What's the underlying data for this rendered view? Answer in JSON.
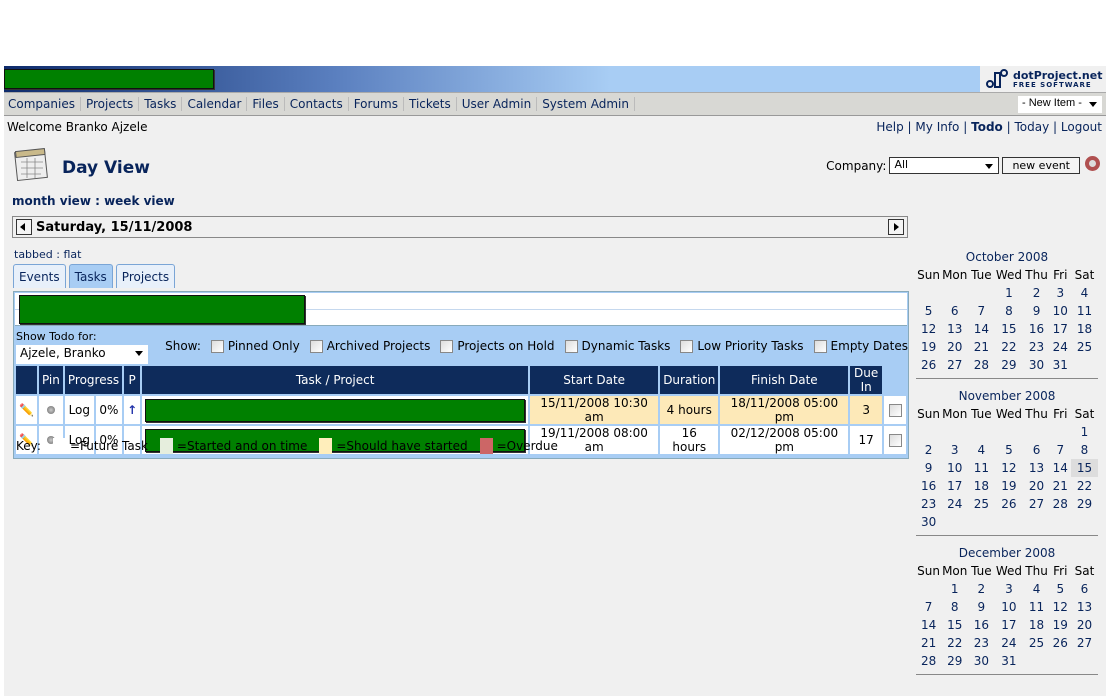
{
  "header": {
    "logo_line1": "dotProject.net",
    "logo_line2": "FREE SOFTWARE",
    "new_item": "- New Item -"
  },
  "nav": [
    "Companies",
    "Projects",
    "Tasks",
    "Calendar",
    "Files",
    "Contacts",
    "Forums",
    "Tickets",
    "User Admin",
    "System Admin"
  ],
  "welcome": "Welcome Branko Ajzele",
  "toplinks": {
    "help": "Help",
    "myinfo": "My Info",
    "todo": "Todo",
    "today": "Today",
    "logout": "Logout",
    "sep": "|"
  },
  "page_title": "Day View",
  "company": {
    "label": "Company:",
    "value": "All",
    "new_event": "new event"
  },
  "views": {
    "month": "month view",
    "sep": " : ",
    "week": "week view"
  },
  "current_day": "Saturday, 15/11/2008",
  "layout_links": {
    "tabbed": "tabbed",
    "sep": " : ",
    "flat": "flat"
  },
  "tabs": [
    {
      "label": "Events"
    },
    {
      "label": "Tasks",
      "active": true
    },
    {
      "label": "Projects"
    }
  ],
  "todo": {
    "show_for_label": "Show Todo for:",
    "user": "Ajzele, Branko",
    "show_label": "Show:",
    "options": [
      "Pinned Only",
      "Archived Projects",
      "Projects on Hold",
      "Dynamic Tasks",
      "Low Priority Tasks",
      "Empty Dates"
    ]
  },
  "columns": [
    "",
    "Pin",
    "Progress",
    "P",
    "Task / Project",
    "Start Date",
    "Duration",
    "Finish Date",
    "Due In"
  ],
  "rows": [
    {
      "log": "Log",
      "progress": "0%",
      "priority": "high",
      "start": "15/11/2008 10:30 am",
      "duration": "4 hours",
      "finish": "18/11/2008 05:00 pm",
      "due_in": "3",
      "status": "should-have-started"
    },
    {
      "log": "Log",
      "progress": "0%",
      "priority": "",
      "start": "19/11/2008 08:00 am",
      "duration": "16 hours",
      "finish": "02/12/2008 05:00 pm",
      "due_in": "17",
      "status": "future"
    }
  ],
  "key": {
    "label": "Key:",
    "items": [
      {
        "label": "=Future Task",
        "color": "#ffffff"
      },
      {
        "label": "=Started and on time",
        "color": "#e6eedd"
      },
      {
        "label": "=Should have started",
        "color": "#ffeebb"
      },
      {
        "label": "=Overdue",
        "color": "#cc6666"
      }
    ]
  },
  "calendar": {
    "weekdays": [
      "Sun",
      "Mon",
      "Tue",
      "Wed",
      "Thu",
      "Fri",
      "Sat"
    ],
    "today": "15/11/2008",
    "months": [
      {
        "title": "October 2008",
        "weeks": [
          [
            "",
            "",
            "",
            "1",
            "2",
            "3",
            "4"
          ],
          [
            "5",
            "6",
            "7",
            "8",
            "9",
            "10",
            "11"
          ],
          [
            "12",
            "13",
            "14",
            "15",
            "16",
            "17",
            "18"
          ],
          [
            "19",
            "20",
            "21",
            "22",
            "23",
            "24",
            "25"
          ],
          [
            "26",
            "27",
            "28",
            "29",
            "30",
            "31",
            ""
          ]
        ]
      },
      {
        "title": "November 2008",
        "today_day": "15",
        "weeks": [
          [
            "",
            "",
            "",
            "",
            "",
            "",
            "1"
          ],
          [
            "2",
            "3",
            "4",
            "5",
            "6",
            "7",
            "8"
          ],
          [
            "9",
            "10",
            "11",
            "12",
            "13",
            "14",
            "15"
          ],
          [
            "16",
            "17",
            "18",
            "19",
            "20",
            "21",
            "22"
          ],
          [
            "23",
            "24",
            "25",
            "26",
            "27",
            "28",
            "29"
          ],
          [
            "30",
            "",
            "",
            "",
            "",
            "",
            ""
          ]
        ]
      },
      {
        "title": "December 2008",
        "weeks": [
          [
            "",
            "1",
            "2",
            "3",
            "4",
            "5",
            "6"
          ],
          [
            "7",
            "8",
            "9",
            "10",
            "11",
            "12",
            "13"
          ],
          [
            "14",
            "15",
            "16",
            "17",
            "18",
            "19",
            "20"
          ],
          [
            "21",
            "22",
            "23",
            "24",
            "25",
            "26",
            "27"
          ],
          [
            "28",
            "29",
            "30",
            "31",
            "",
            "",
            ""
          ]
        ]
      }
    ]
  }
}
